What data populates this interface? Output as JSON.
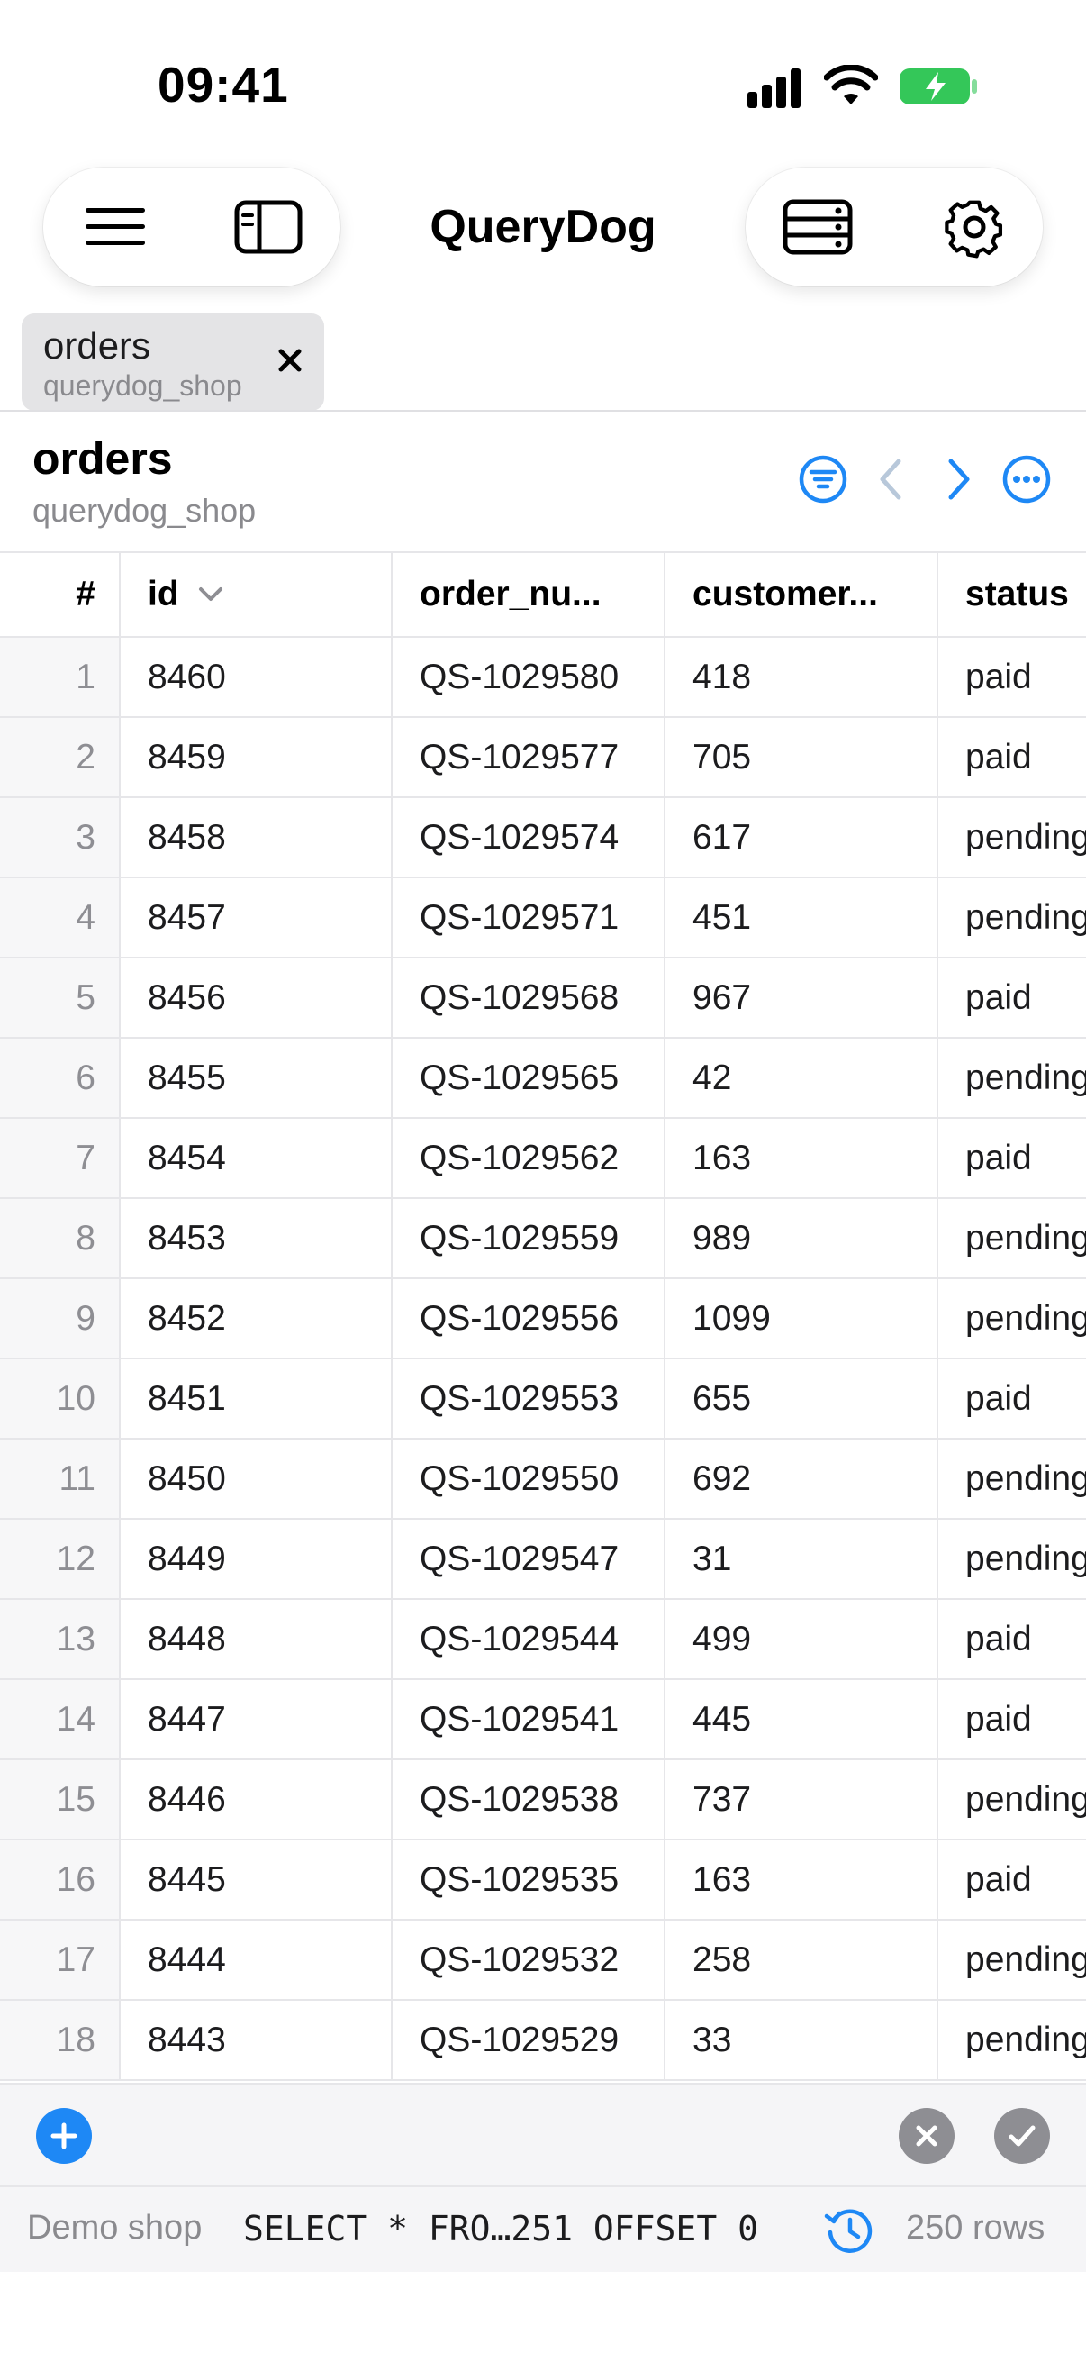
{
  "status_bar": {
    "time": "09:41"
  },
  "nav": {
    "title": "QueryDog",
    "menu_icon": "hamburger-icon",
    "sidebar_icon": "sidebar-icon",
    "database_icon": "server-stack-icon",
    "settings_icon": "gear-icon"
  },
  "tab": {
    "name": "orders",
    "database": "querydog_shop"
  },
  "table": {
    "title": "orders",
    "subtitle": "querydog_shop",
    "columns": [
      "#",
      "id",
      "order_nu...",
      "customer...",
      "status"
    ],
    "rows": [
      {
        "n": "1",
        "id": "8460",
        "order_number": "QS-1029580",
        "customer": "418",
        "status": "paid"
      },
      {
        "n": "2",
        "id": "8459",
        "order_number": "QS-1029577",
        "customer": "705",
        "status": "paid"
      },
      {
        "n": "3",
        "id": "8458",
        "order_number": "QS-1029574",
        "customer": "617",
        "status": "pending"
      },
      {
        "n": "4",
        "id": "8457",
        "order_number": "QS-1029571",
        "customer": "451",
        "status": "pending"
      },
      {
        "n": "5",
        "id": "8456",
        "order_number": "QS-1029568",
        "customer": "967",
        "status": "paid"
      },
      {
        "n": "6",
        "id": "8455",
        "order_number": "QS-1029565",
        "customer": "42",
        "status": "pending"
      },
      {
        "n": "7",
        "id": "8454",
        "order_number": "QS-1029562",
        "customer": "163",
        "status": "paid"
      },
      {
        "n": "8",
        "id": "8453",
        "order_number": "QS-1029559",
        "customer": "989",
        "status": "pending"
      },
      {
        "n": "9",
        "id": "8452",
        "order_number": "QS-1029556",
        "customer": "1099",
        "status": "pending"
      },
      {
        "n": "10",
        "id": "8451",
        "order_number": "QS-1029553",
        "customer": "655",
        "status": "paid"
      },
      {
        "n": "11",
        "id": "8450",
        "order_number": "QS-1029550",
        "customer": "692",
        "status": "pending"
      },
      {
        "n": "12",
        "id": "8449",
        "order_number": "QS-1029547",
        "customer": "31",
        "status": "pending"
      },
      {
        "n": "13",
        "id": "8448",
        "order_number": "QS-1029544",
        "customer": "499",
        "status": "paid"
      },
      {
        "n": "14",
        "id": "8447",
        "order_number": "QS-1029541",
        "customer": "445",
        "status": "paid"
      },
      {
        "n": "15",
        "id": "8446",
        "order_number": "QS-1029538",
        "customer": "737",
        "status": "pending"
      },
      {
        "n": "16",
        "id": "8445",
        "order_number": "QS-1029535",
        "customer": "163",
        "status": "paid"
      },
      {
        "n": "17",
        "id": "8444",
        "order_number": "QS-1029532",
        "customer": "258",
        "status": "pending"
      },
      {
        "n": "18",
        "id": "8443",
        "order_number": "QS-1029529",
        "customer": "33",
        "status": "pending"
      }
    ]
  },
  "footer": {
    "connection": "Demo shop",
    "query": "SELECT * FRO…251 OFFSET 0",
    "row_count": "250 rows"
  },
  "colors": {
    "accent": "#1e88f5",
    "battery": "#34c759",
    "muted": "#8e8e93"
  }
}
